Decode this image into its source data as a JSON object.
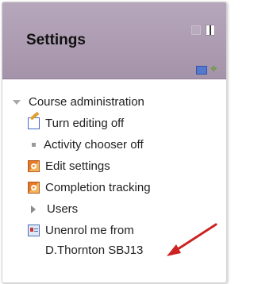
{
  "block": {
    "title": "Settings",
    "header_icons": [
      "hide-block-icon",
      "dock-icon",
      "edit-icon",
      "move-icon"
    ]
  },
  "tree": {
    "section": "Course administration",
    "items": [
      {
        "label": "Turn editing off",
        "icon": "pencil-edit-icon"
      },
      {
        "label": "Activity chooser off",
        "icon": "bullet-icon"
      },
      {
        "label": "Edit settings",
        "icon": "settings-icon"
      },
      {
        "label": "Completion tracking",
        "icon": "settings-icon"
      },
      {
        "label": "Users",
        "icon": "expand-arrow-icon"
      },
      {
        "label": "Unenrol me from",
        "icon": "unenrol-icon"
      },
      {
        "label": "D.Thornton  SBJ13",
        "icon": ""
      }
    ]
  },
  "annotation": {
    "arrow_color": "#cc2222"
  }
}
